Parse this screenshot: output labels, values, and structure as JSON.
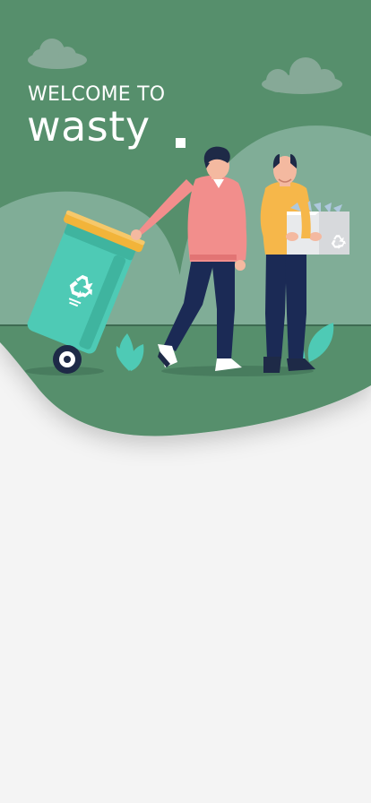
{
  "hero": {
    "welcome_text": "WELCOME TO",
    "app_name": "wasty",
    "illustration": "recycling-people-illustration"
  },
  "bin": {
    "icon": "recycle-icon"
  },
  "box": {
    "icon": "recycle-icon"
  },
  "colors": {
    "hero_green": "#568f6c",
    "hill_green": "#80ad97",
    "cloud": "#86a997",
    "bin_teal": "#4ecab5",
    "bin_lid": "#f2b43a",
    "shirt_pink": "#f28e8c",
    "shirt_yellow": "#f6b74a",
    "pants_navy": "#1b2a55",
    "background": "#f4f4f4"
  }
}
